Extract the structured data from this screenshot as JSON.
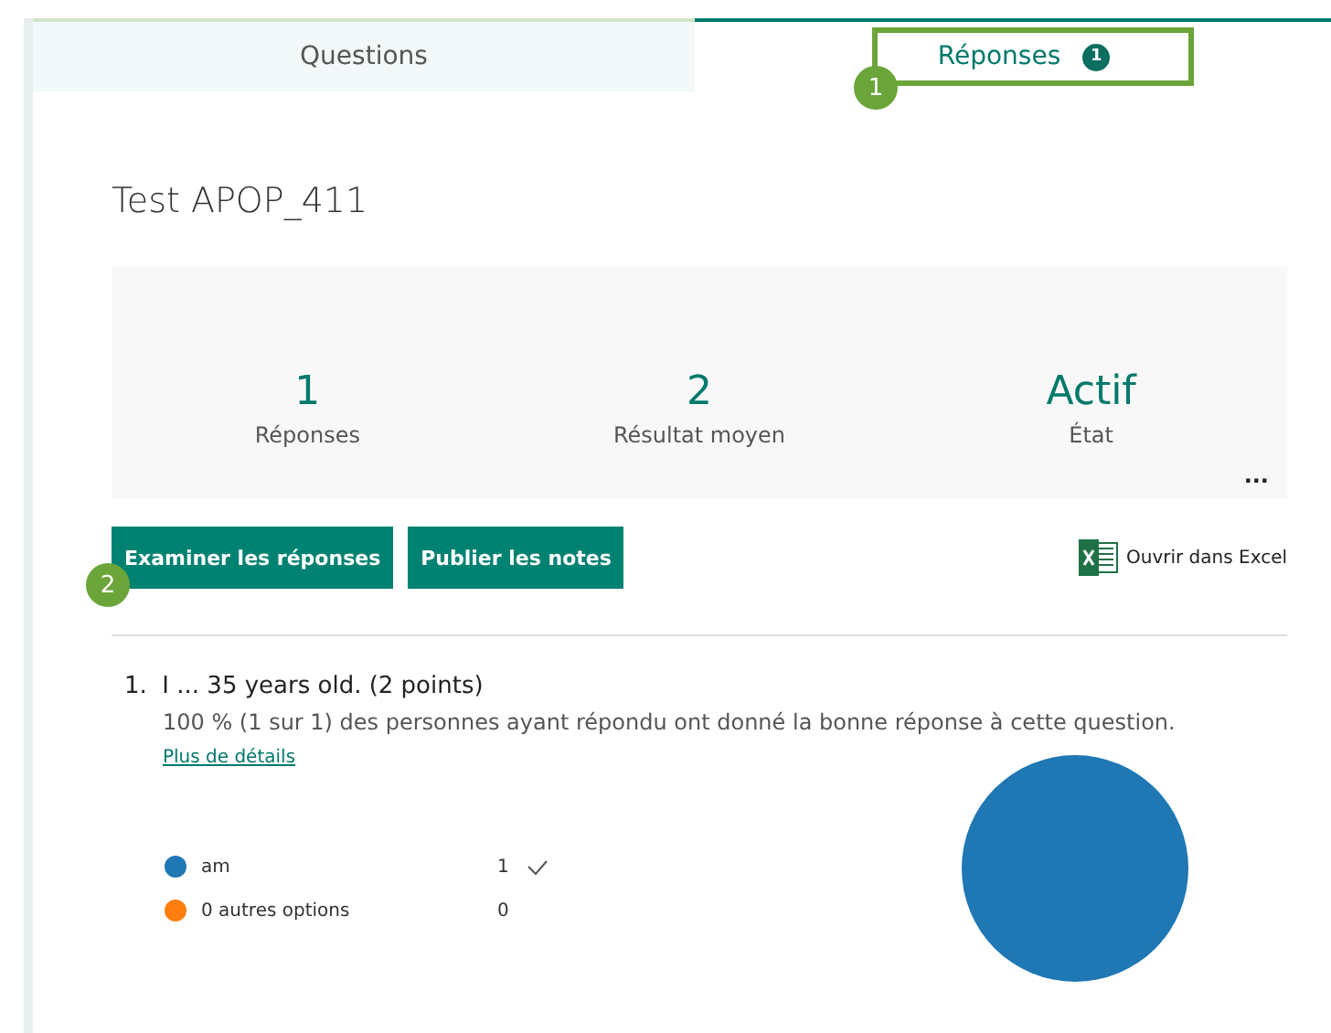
{
  "tabs": [
    {
      "label": "Questions",
      "selected": false
    },
    {
      "label": "Réponses",
      "selected": true,
      "badge": "1"
    }
  ],
  "callouts": [
    {
      "number": "1"
    },
    {
      "number": "2"
    }
  ],
  "form_title": "Test APOP_411",
  "stats": [
    {
      "value": "1",
      "label": "Réponses"
    },
    {
      "value": "2",
      "label": "Résultat moyen"
    },
    {
      "value": "Actif",
      "label": "État"
    }
  ],
  "more_label": "...",
  "buttons": [
    "Examiner les réponses",
    "Publier les notes"
  ],
  "excel_link": "Ouvrir dans Excel",
  "question": {
    "number": "1.",
    "title": "I ... 35 years old. (2 points)",
    "summary": "100 % (1 sur 1) des personnes ayant répondu ont donné la bonne réponse à cette question.",
    "details_link": "Plus de détails",
    "options": [
      {
        "label": "am",
        "count": "1",
        "color": "#1f77b4",
        "correct": true
      },
      {
        "label": "0 autres options",
        "count": "0",
        "color": "#ff7f0e",
        "correct": false
      }
    ]
  }
}
